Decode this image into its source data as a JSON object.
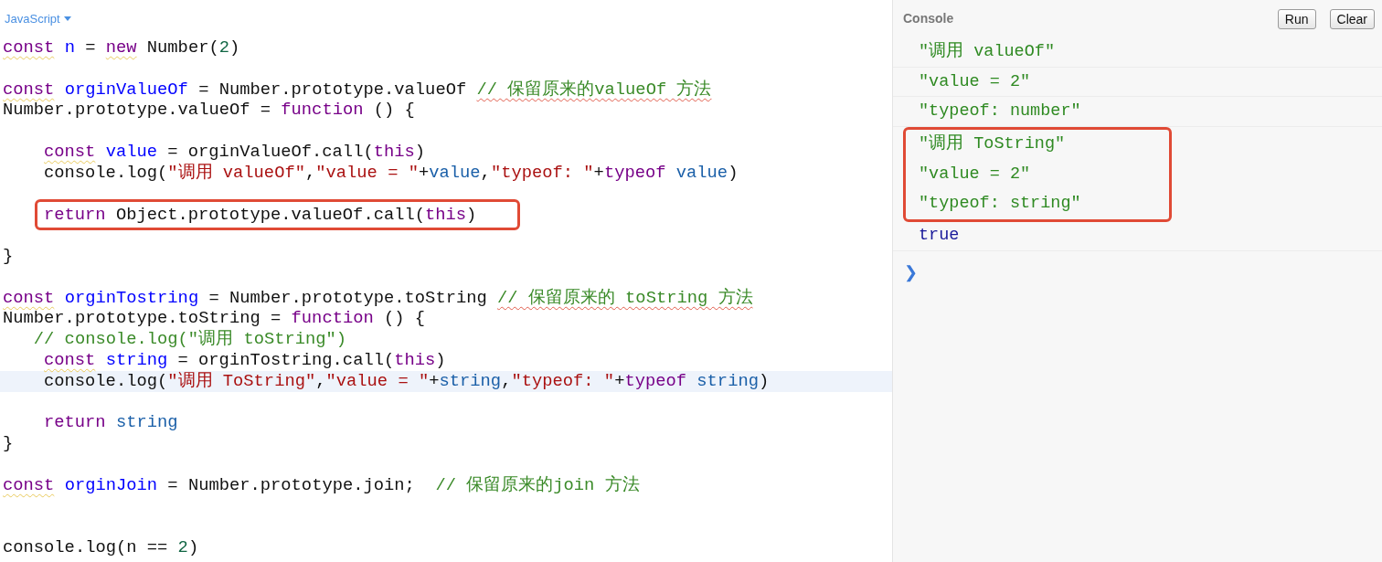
{
  "editor": {
    "language": "JavaScript",
    "lines": [
      {
        "kind": "code",
        "active": false,
        "boxed": false,
        "indented": false,
        "tokens": [
          {
            "text": "const",
            "kind": "keyword",
            "flagged": true
          },
          {
            "text": " n",
            "kind": "def",
            "flagged": false
          },
          {
            "text": " = ",
            "kind": "plain",
            "flagged": false
          },
          {
            "text": "new",
            "kind": "keyword",
            "flagged": true
          },
          {
            "text": " Number(",
            "kind": "plain",
            "flagged": false
          },
          {
            "text": "2",
            "kind": "number",
            "flagged": false
          },
          {
            "text": ")",
            "kind": "plain",
            "flagged": false
          }
        ]
      },
      {
        "kind": "blank"
      },
      {
        "kind": "code",
        "active": false,
        "boxed": false,
        "indented": false,
        "tokens": [
          {
            "text": "const",
            "kind": "keyword",
            "flagged": true
          },
          {
            "text": " orginValueOf",
            "kind": "def",
            "flagged": false
          },
          {
            "text": " = Number.prototype.valueOf ",
            "kind": "plain",
            "flagged": false
          },
          {
            "text": "// 保留原来的valueOf 方法",
            "kind": "comment",
            "flagged": true
          }
        ]
      },
      {
        "kind": "code",
        "active": false,
        "boxed": false,
        "indented": false,
        "tokens": [
          {
            "text": "Number.prototype.valueOf = ",
            "kind": "plain",
            "flagged": false
          },
          {
            "text": "function",
            "kind": "keyword",
            "flagged": false
          },
          {
            "text": " () {",
            "kind": "plain",
            "flagged": false
          }
        ]
      },
      {
        "kind": "blank"
      },
      {
        "kind": "code",
        "active": false,
        "boxed": false,
        "indented": true,
        "tokens": [
          {
            "text": "const",
            "kind": "keyword",
            "flagged": true
          },
          {
            "text": " value",
            "kind": "def",
            "flagged": false
          },
          {
            "text": " = orginValueOf.call(",
            "kind": "plain",
            "flagged": false
          },
          {
            "text": "this",
            "kind": "keyword",
            "flagged": false
          },
          {
            "text": ")",
            "kind": "plain",
            "flagged": false
          }
        ]
      },
      {
        "kind": "code",
        "active": false,
        "boxed": false,
        "indented": true,
        "tokens": [
          {
            "text": "console.log(",
            "kind": "plain",
            "flagged": false
          },
          {
            "text": "\"调用 valueOf\"",
            "kind": "string",
            "flagged": false
          },
          {
            "text": ",",
            "kind": "plain",
            "flagged": false
          },
          {
            "text": "\"value = \"",
            "kind": "string",
            "flagged": false
          },
          {
            "text": "+",
            "kind": "plain",
            "flagged": false
          },
          {
            "text": "value",
            "kind": "variable",
            "flagged": false
          },
          {
            "text": ",",
            "kind": "plain",
            "flagged": false
          },
          {
            "text": "\"typeof: \"",
            "kind": "string",
            "flagged": false
          },
          {
            "text": "+",
            "kind": "plain",
            "flagged": false
          },
          {
            "text": "typeof",
            "kind": "keyword",
            "flagged": false
          },
          {
            "text": " value",
            "kind": "variable",
            "flagged": false
          },
          {
            "text": ")",
            "kind": "plain",
            "flagged": false
          }
        ]
      },
      {
        "kind": "blank"
      },
      {
        "kind": "code",
        "active": false,
        "boxed": true,
        "indented": true,
        "tokens": [
          {
            "text": "return",
            "kind": "keyword",
            "flagged": false
          },
          {
            "text": " Object.prototype.valueOf.call(",
            "kind": "plain",
            "flagged": false
          },
          {
            "text": "this",
            "kind": "keyword",
            "flagged": false
          },
          {
            "text": ")",
            "kind": "plain",
            "flagged": false
          }
        ]
      },
      {
        "kind": "blank"
      },
      {
        "kind": "code",
        "active": false,
        "boxed": false,
        "indented": false,
        "tokens": [
          {
            "text": "}",
            "kind": "plain",
            "flagged": false
          }
        ]
      },
      {
        "kind": "blank"
      },
      {
        "kind": "code",
        "active": false,
        "boxed": false,
        "indented": false,
        "tokens": [
          {
            "text": "const",
            "kind": "keyword",
            "flagged": true
          },
          {
            "text": " orginTostring",
            "kind": "def",
            "flagged": false
          },
          {
            "text": " = Number.prototype.toString ",
            "kind": "plain",
            "flagged": false
          },
          {
            "text": "// 保留原来的 toString 方法",
            "kind": "comment",
            "flagged": true
          }
        ]
      },
      {
        "kind": "code",
        "active": false,
        "boxed": false,
        "indented": false,
        "tokens": [
          {
            "text": "Number.prototype.toString = ",
            "kind": "plain",
            "flagged": false
          },
          {
            "text": "function",
            "kind": "keyword",
            "flagged": false
          },
          {
            "text": " () {",
            "kind": "plain",
            "flagged": false
          }
        ]
      },
      {
        "kind": "code",
        "active": false,
        "boxed": false,
        "indented": false,
        "tokens": [
          {
            "text": "   // console.log(\"调用 toString\")",
            "kind": "comment",
            "flagged": false
          }
        ]
      },
      {
        "kind": "code",
        "active": false,
        "boxed": false,
        "indented": true,
        "tokens": [
          {
            "text": "const",
            "kind": "keyword",
            "flagged": true
          },
          {
            "text": " string",
            "kind": "def",
            "flagged": false
          },
          {
            "text": " = orginTostring.call(",
            "kind": "plain",
            "flagged": false
          },
          {
            "text": "this",
            "kind": "keyword",
            "flagged": false
          },
          {
            "text": ")",
            "kind": "plain",
            "flagged": false
          }
        ]
      },
      {
        "kind": "code",
        "active": true,
        "boxed": false,
        "indented": true,
        "tokens": [
          {
            "text": "console.log(",
            "kind": "plain",
            "flagged": false
          },
          {
            "text": "\"调用 ToString\"",
            "kind": "string",
            "flagged": false
          },
          {
            "text": ",",
            "kind": "plain",
            "flagged": false
          },
          {
            "text": "\"value = \"",
            "kind": "string",
            "flagged": false
          },
          {
            "text": "+",
            "kind": "plain",
            "flagged": false
          },
          {
            "text": "string",
            "kind": "variable",
            "flagged": false
          },
          {
            "text": ",",
            "kind": "plain",
            "flagged": false
          },
          {
            "text": "\"typeof: \"",
            "kind": "string",
            "flagged": false
          },
          {
            "text": "+",
            "kind": "plain",
            "flagged": false
          },
          {
            "text": "typeof",
            "kind": "keyword",
            "flagged": false
          },
          {
            "text": " string",
            "kind": "variable",
            "flagged": false
          },
          {
            "text": ")",
            "kind": "plain",
            "flagged": false
          }
        ]
      },
      {
        "kind": "blank"
      },
      {
        "kind": "code",
        "active": false,
        "boxed": false,
        "indented": true,
        "tokens": [
          {
            "text": "return",
            "kind": "keyword",
            "flagged": false
          },
          {
            "text": " string",
            "kind": "variable",
            "flagged": false
          }
        ]
      },
      {
        "kind": "code",
        "active": false,
        "boxed": false,
        "indented": false,
        "tokens": [
          {
            "text": "}",
            "kind": "plain",
            "flagged": false
          }
        ]
      },
      {
        "kind": "blank"
      },
      {
        "kind": "code",
        "active": false,
        "boxed": false,
        "indented": false,
        "tokens": [
          {
            "text": "const",
            "kind": "keyword",
            "flagged": true
          },
          {
            "text": " orginJoin",
            "kind": "def",
            "flagged": false
          },
          {
            "text": " = Number.prototype.join;  ",
            "kind": "plain",
            "flagged": false
          },
          {
            "text": "// 保留原来的join 方法",
            "kind": "comment",
            "flagged": false
          }
        ]
      },
      {
        "kind": "blank"
      },
      {
        "kind": "blank"
      },
      {
        "kind": "code",
        "active": false,
        "boxed": false,
        "indented": false,
        "tokens": [
          {
            "text": "console.log(n == ",
            "kind": "plain",
            "flagged": false
          },
          {
            "text": "2",
            "kind": "number",
            "flagged": false
          },
          {
            "text": ")",
            "kind": "plain",
            "flagged": false
          }
        ]
      }
    ]
  },
  "console": {
    "title": "Console",
    "buttons": [
      "Run",
      "Clear"
    ],
    "entries": [
      {
        "text": "\"调用 valueOf\"",
        "kind": "string",
        "boxed": false
      },
      {
        "text": "\"value = 2\"",
        "kind": "string",
        "boxed": false
      },
      {
        "text": "\"typeof: number\"",
        "kind": "string",
        "boxed": false
      },
      {
        "text": "\"调用 ToString\"",
        "kind": "string",
        "boxed": true
      },
      {
        "text": "\"value = 2\"",
        "kind": "string",
        "boxed": true
      },
      {
        "text": "\"typeof: string\"",
        "kind": "string",
        "boxed": true
      },
      {
        "text": "true",
        "kind": "boolean",
        "boxed": false
      }
    ],
    "prompt": "❯"
  }
}
